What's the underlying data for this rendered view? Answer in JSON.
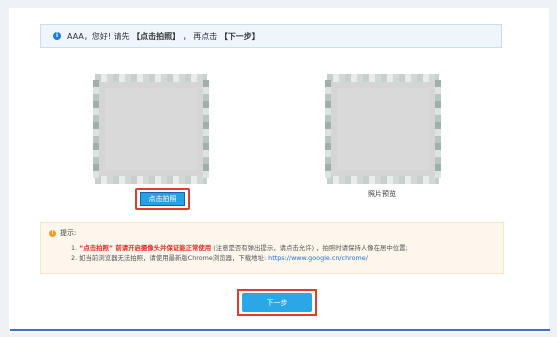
{
  "info": {
    "text_prefix": "AAA，您好! 请先",
    "action1": "【点击拍照】",
    "text_mid": "，  再点击",
    "action2": "【下一步】"
  },
  "capture": {
    "button_label": "点击拍照"
  },
  "preview": {
    "label": "照片预览"
  },
  "tips": {
    "title": "提示:",
    "line1_prefix": "1. ",
    "line1_red": "“点击拍照” 前请开启摄像头并保证能正常使用",
    "line1_rest": " (注意是否有弹出提示，请点击允许) ，拍照时请保持人像在居中位置;",
    "line2_text": "2. 如当前浏览器无法拍照，请使用最新版Chrome浏览器，下载地址: ",
    "line2_link": "https://www.google.cn/chrome/"
  },
  "next": {
    "button_label": "下一步"
  },
  "colors": {
    "accent": "#29a7e6",
    "highlight_border": "#e23a2e",
    "warning": "#f29c1f",
    "link": "#1f6fd0"
  }
}
